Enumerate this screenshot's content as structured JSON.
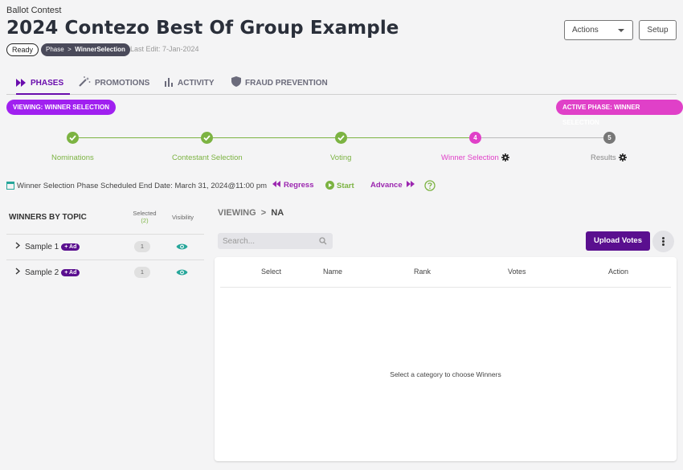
{
  "header": {
    "breadcrumb": "Ballot Contest",
    "title": "2024 Contezo Best Of Group Example",
    "status_badge": "Ready",
    "phase_badge_prefix": "Phase",
    "phase_badge_value": "WinnerSelection",
    "last_edit": "Last Edit: 7-Jan-2024",
    "actions_label": "Actions",
    "setup_label": "Setup"
  },
  "tabs": [
    {
      "label": "PHASES",
      "icon": "fast-forward-icon",
      "active": true
    },
    {
      "label": "PROMOTIONS",
      "icon": "magic-wand-icon",
      "active": false
    },
    {
      "label": "ACTIVITY",
      "icon": "bar-chart-icon",
      "active": false
    },
    {
      "label": "FRAUD PREVENTION",
      "icon": "shield-icon",
      "active": false
    }
  ],
  "pills": {
    "viewing": "VIEWING:  WINNER SELECTION",
    "active_phase": "ACTIVE PHASE:  WINNER SELECTION"
  },
  "stepper": [
    {
      "label": "Nominations",
      "state": "done",
      "marker": ""
    },
    {
      "label": "Contestant Selection",
      "state": "done",
      "marker": ""
    },
    {
      "label": "Voting",
      "state": "done",
      "marker": ""
    },
    {
      "label": "Winner Selection",
      "state": "current",
      "marker": "4"
    },
    {
      "label": "Results",
      "state": "todo",
      "marker": "5"
    }
  ],
  "schedule": {
    "end_date": "Winner Selection Phase Scheduled End Date: March 31, 2024@11:00 pm",
    "regress": "Regress",
    "start": "Start",
    "advance": "Advance"
  },
  "winners_panel": {
    "title": "WINNERS BY TOPIC",
    "selected_header": "Selected",
    "selected_count": "(2)",
    "visibility_header": "Visibility",
    "topics": [
      {
        "label": "Sample 1",
        "ad": "+ Ad",
        "count": "1"
      },
      {
        "label": "Sample 2",
        "ad": "+ Ad",
        "count": "1"
      }
    ]
  },
  "main": {
    "viewing_prefix": "VIEWING",
    "viewing_value": "NA",
    "search_placeholder": "Search...",
    "upload_label": "Upload Votes",
    "columns": [
      "Select",
      "Name",
      "Rank",
      "Votes",
      "Action"
    ],
    "empty_message": "Select a category to choose Winners"
  },
  "colors": {
    "brand_purple": "#5a0f8f",
    "viewing_purple": "#a020f0",
    "active_pink": "#e040c8",
    "done_green": "#7cb342",
    "eye_teal": "#26a69a"
  }
}
